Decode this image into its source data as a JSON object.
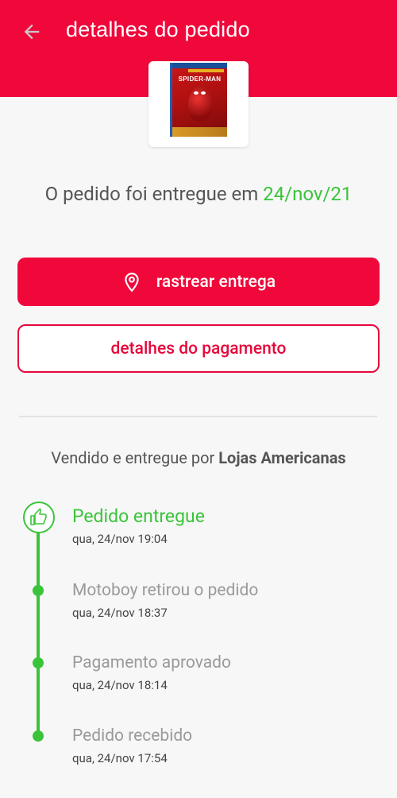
{
  "header": {
    "title": "detalhes do pedido",
    "back_icon": "arrow-left-icon",
    "background_color": "#f0083b"
  },
  "product": {
    "image_alt": "Marvel's Spider-Man PS4",
    "cover_text": "SPIDER-MAN"
  },
  "status": {
    "prefix": "O pedido foi entregue em",
    "date": "24/nov/21"
  },
  "buttons": {
    "track_label": "rastrear entrega",
    "track_icon": "location-pin-icon",
    "payment_label": "detalhes do pagamento"
  },
  "seller": {
    "prefix": "Vendido e entregue por",
    "name": "Lojas Americanas"
  },
  "timeline": [
    {
      "title": "Pedido entregue",
      "time": "qua, 24/nov 19:04",
      "active": true,
      "icon": "thumbs-up-icon"
    },
    {
      "title": "Motoboy retirou o pedido",
      "time": "qua, 24/nov 18:37",
      "active": false
    },
    {
      "title": "Pagamento aprovado",
      "time": "qua, 24/nov 18:14",
      "active": false
    },
    {
      "title": "Pedido recebido",
      "time": "qua, 24/nov 17:54",
      "active": false
    }
  ],
  "colors": {
    "accent": "#f0083b",
    "success": "#3ac43a",
    "text": "#555555"
  }
}
